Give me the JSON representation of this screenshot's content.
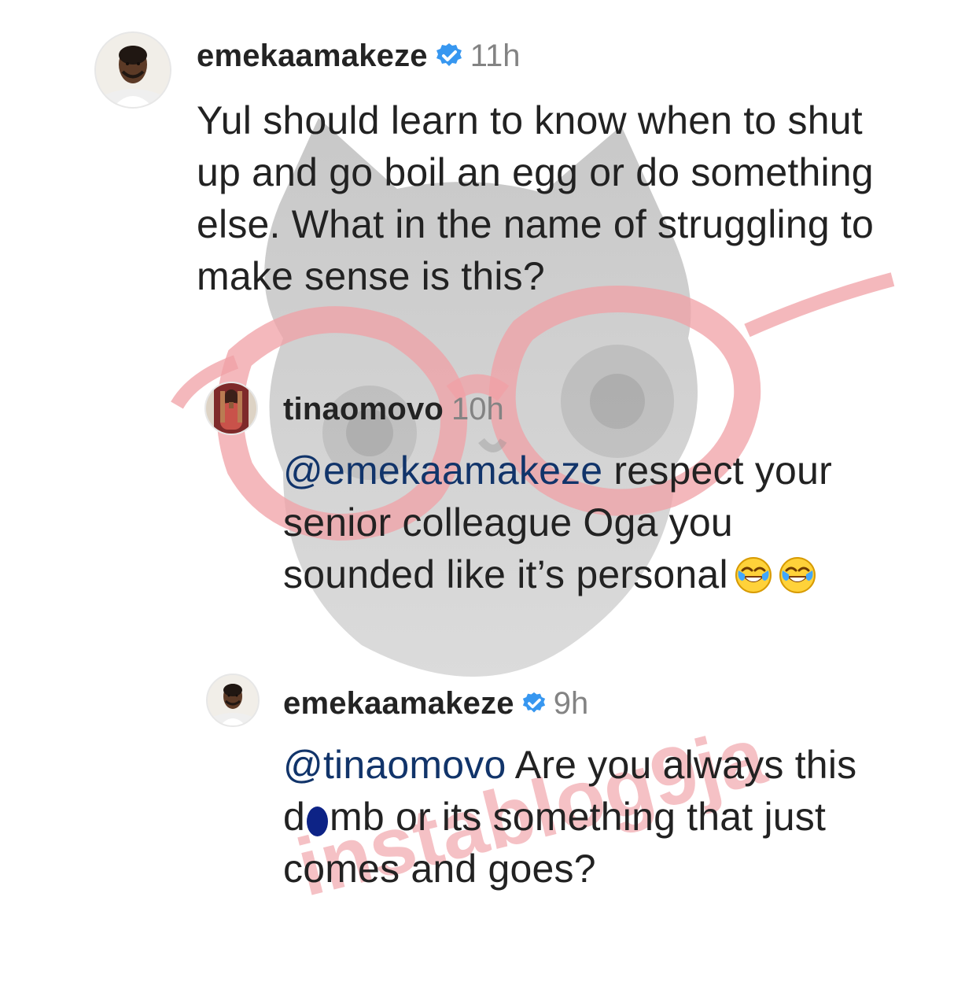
{
  "comments": [
    {
      "username": "emekaamakeze",
      "verified": true,
      "time": "11h",
      "text": "Yul should learn to know when to shut up and go boil an egg or do something else. What in the name of struggling to make sense is this?"
    },
    {
      "username": "tinaomovo",
      "verified": false,
      "time": "10h",
      "mention": "@emekaamakeze",
      "text": " respect your senior colleague Oga you sounded like it’s personal",
      "emoji": "face-with-tears-of-joy-icon"
    },
    {
      "username": "emekaamakeze",
      "verified": true,
      "time": "9h",
      "mention": "@tinaomovo",
      "text_before_censor": " Are you always this d",
      "text_after_censor": "mb or its something that just comes and goes?"
    }
  ],
  "watermark": {
    "text": "instablog9ja",
    "colors": {
      "accent": "#f0a0a6",
      "cat": "#9b9b9b"
    }
  },
  "colors": {
    "username": "#232323",
    "time": "#838383",
    "mention": "#11346a",
    "verified": "#3797f0",
    "censor": "#0d2386"
  },
  "icons": {
    "verified": "verified-badge-icon",
    "emoji": "face-with-tears-of-joy-icon"
  }
}
